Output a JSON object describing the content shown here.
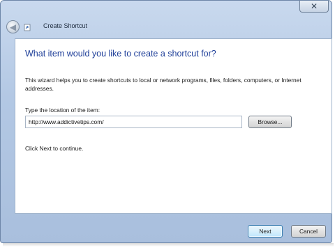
{
  "window": {
    "title": "Create Shortcut",
    "close_glyph": "✕",
    "back_glyph": "◀",
    "icons": [
      "back-arrow-icon",
      "shortcut-icon",
      "close-icon"
    ]
  },
  "page": {
    "heading": "What item would you like to create a shortcut for?",
    "description": "This wizard helps you to create shortcuts to local or network programs, files, folders, computers, or Internet addresses.",
    "location_label": "Type the location of the item:",
    "location_value": "http://www.addictivetips.com/",
    "browse_label": "Browse...",
    "hint": "Click Next to continue."
  },
  "footer": {
    "next_label": "Next",
    "cancel_label": "Cancel"
  },
  "colors": {
    "heading": "#1f3f99",
    "frame": "#b3c8e4",
    "default_button_border": "#3c7fb1"
  }
}
